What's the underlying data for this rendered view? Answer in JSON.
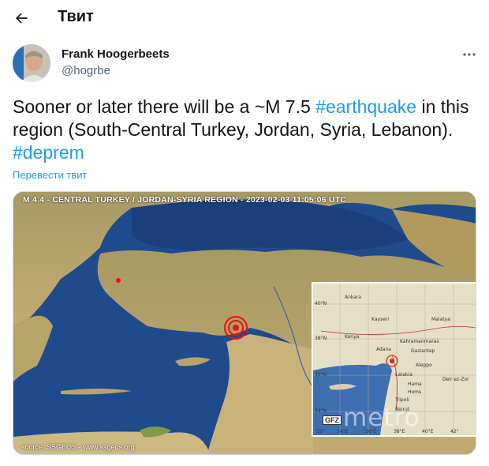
{
  "header": {
    "title": "Твит",
    "back_icon": "arrow-left-icon"
  },
  "author": {
    "name": "Frank Hoogerbeets",
    "handle": "@hogrbe",
    "more_icon": "more-dots-icon"
  },
  "tweet": {
    "text_before": "Sooner or later there will be a ~M 7.5 ",
    "hashtag1": "#earthquake",
    "text_middle": " in this region (South-Central Turkey, Jordan, Syria, Lebanon). ",
    "hashtag2": "#deprem",
    "translate": "Перевести твит"
  },
  "media": {
    "map_title": "M 4.4 - CENTRAL TURKEY / JORDAN-SYRIA REGION - 2023-02-03 11:05:06 UTC",
    "source": "source: SSGEOS - www.ssgeos.org",
    "watermark": "metro",
    "inset": {
      "logo": "GFZ",
      "lat_labels": [
        "40°N",
        "38°N",
        "36°N",
        "34°N"
      ],
      "lon_labels": [
        "32°",
        "34°E",
        "36°E",
        "38°E",
        "40°E",
        "42°"
      ],
      "cities": [
        "Ankara",
        "Kayseri",
        "Malatya",
        "Konya",
        "Kahramanmaras",
        "Adana",
        "Gaziantep",
        "Aleppo",
        "Latakia",
        "Hama",
        "Homs",
        "Tripoli",
        "Beirut",
        "Deir ez-Zor"
      ]
    }
  }
}
